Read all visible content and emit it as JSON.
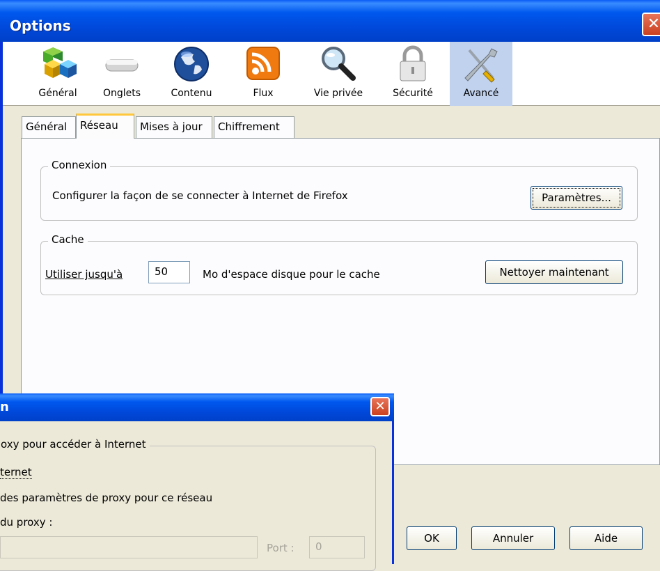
{
  "window": {
    "title": "Options",
    "close_glyph": "✕"
  },
  "panes": [
    {
      "label": "Général",
      "icon": "general-blocks-icon"
    },
    {
      "label": "Onglets",
      "icon": "tabs-icon"
    },
    {
      "label": "Contenu",
      "icon": "globe-icon"
    },
    {
      "label": "Flux",
      "icon": "rss-feed-icon"
    },
    {
      "label": "Vie privée",
      "icon": "magnifier-icon"
    },
    {
      "label": "Sécurité",
      "icon": "padlock-icon"
    },
    {
      "label": "Avancé",
      "icon": "tools-icon",
      "selected": true
    }
  ],
  "tabs": [
    {
      "label": "Général"
    },
    {
      "label": "Réseau",
      "active": true
    },
    {
      "label": "Mises à jour"
    },
    {
      "label": "Chiffrement"
    }
  ],
  "connexion": {
    "legend": "Connexion",
    "description": "Configurer la façon de se connecter à Internet de Firefox",
    "settings_button": "Paramètres..."
  },
  "cache": {
    "legend": "Cache",
    "use_label": "Utiliser jusqu'à",
    "size_value": "50",
    "unit_label": "Mo d'espace disque pour le cache",
    "clear_button": "Nettoyer maintenant"
  },
  "footer": {
    "ok": "OK",
    "cancel": "Annuler",
    "help": "Aide"
  },
  "dialog": {
    "title": "n",
    "close_glyph": "✕",
    "group_legend": "oxy pour accéder à Internet",
    "option_direct": "ternet",
    "option_auto": "des paramètres de proxy pour ce réseau",
    "option_manual": "du proxy :",
    "port_label": "Port :",
    "port_value": "0"
  },
  "colors": {
    "titlebar": "#0058ee",
    "selected_pane": "#c1d2ee",
    "active_tab_accent": "#ffc83c",
    "close_red": "#c9401f"
  }
}
